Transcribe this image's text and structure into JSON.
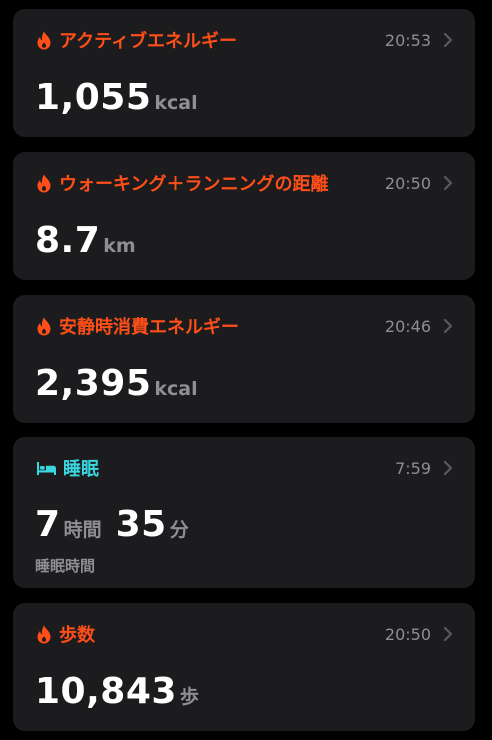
{
  "colors": {
    "background": "#000000",
    "card": "#1c1c1e",
    "activity_accent": "#ff4f18",
    "sleep_accent": "#39d7df",
    "secondary_text": "#8e8e93"
  },
  "cards": [
    {
      "icon": "flame-icon",
      "title": "アクティブエネルギー",
      "time": "20:53",
      "value": "1,055",
      "unit": "kcal"
    },
    {
      "icon": "flame-icon",
      "title": "ウォーキング＋ランニングの距離",
      "time": "20:50",
      "value": "8.7",
      "unit": "km"
    },
    {
      "icon": "flame-icon",
      "title": "安静時消費エネルギー",
      "time": "20:46",
      "value": "2,395",
      "unit": "kcal"
    },
    {
      "icon": "bed-icon",
      "title": "睡眠",
      "time": "7:59",
      "hours_value": "7",
      "hours_unit": "時間",
      "minutes_value": "35",
      "minutes_unit": "分",
      "sub_label": "睡眠時間"
    },
    {
      "icon": "flame-icon",
      "title": "歩数",
      "time": "20:50",
      "value": "10,843",
      "unit": "歩"
    }
  ]
}
